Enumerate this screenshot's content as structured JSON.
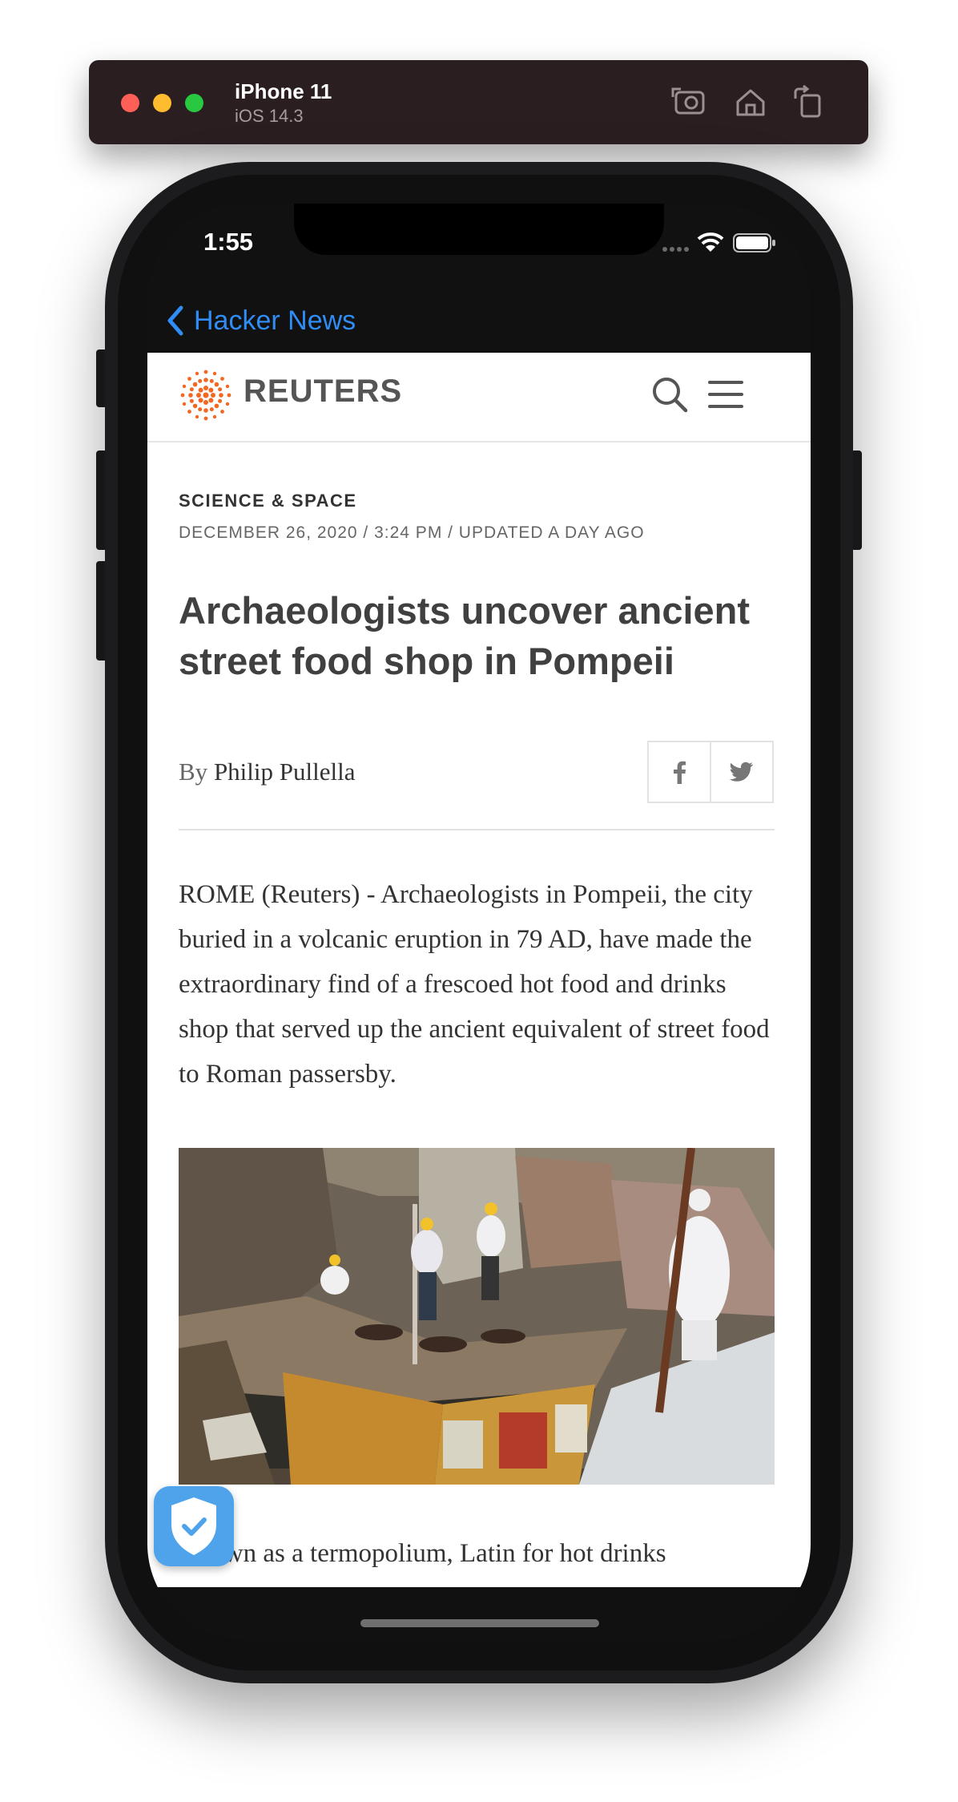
{
  "simulator": {
    "device_name": "iPhone 11",
    "os_version": "iOS 14.3",
    "tools": [
      "screenshot-icon",
      "home-icon",
      "rotate-icon"
    ]
  },
  "status_bar": {
    "time": "1:55"
  },
  "nav": {
    "back_label": "Hacker News",
    "accent_color": "#2f8df5"
  },
  "site": {
    "brand": "REUTERS",
    "brand_color": "#f26722"
  },
  "article": {
    "section": "SCIENCE & SPACE",
    "dateline": "DECEMBER 26, 2020 / 3:24 PM / UPDATED A DAY AGO",
    "headline": "Archaeologists uncover ancient street food shop in Pompeii",
    "by_prefix": "By",
    "author": "Philip Pullella",
    "paragraph1": "ROME (Reuters) - Archaeologists in Pompeii, the city buried in a volcanic eruption in 79 AD, have made the extraordinary find of a frescoed hot food and drinks shop that served up the ancient equivalent of street food to Roman passersby.",
    "paragraph2_visible": "Known as a termopolium, Latin for hot drinks"
  }
}
